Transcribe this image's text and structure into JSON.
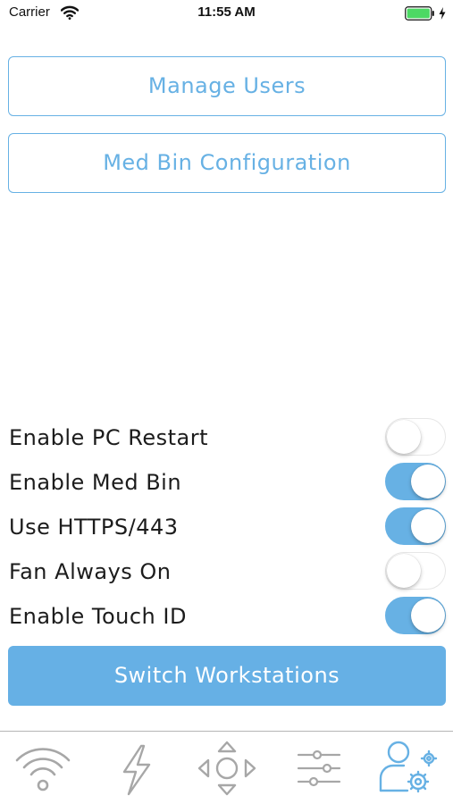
{
  "status_bar": {
    "carrier": "Carrier",
    "time": "11:55 AM",
    "battery_color": "#4cd964"
  },
  "buttons": {
    "manage_users": "Manage Users",
    "med_bin_configuration": "Med Bin Configuration",
    "switch_workstations": "Switch Workstations"
  },
  "settings": [
    {
      "label": "Enable PC Restart",
      "enabled": false
    },
    {
      "label": "Enable Med Bin",
      "enabled": true
    },
    {
      "label": "Use HTTPS/443",
      "enabled": true
    },
    {
      "label": "Fan Always On",
      "enabled": false
    },
    {
      "label": "Enable Touch ID",
      "enabled": true
    }
  ],
  "tab_bar": {
    "tabs": [
      {
        "icon": "wifi-icon",
        "selected": false
      },
      {
        "icon": "lightning-icon",
        "selected": false
      },
      {
        "icon": "directional-pad-icon",
        "selected": false
      },
      {
        "icon": "sliders-icon",
        "selected": false
      },
      {
        "icon": "user-settings-icon",
        "selected": true
      }
    ]
  },
  "colors": {
    "accent": "#67b1e4",
    "toggle_off_border": "#e6e6e6",
    "tab_icon_inactive": "#a7a7a7"
  }
}
